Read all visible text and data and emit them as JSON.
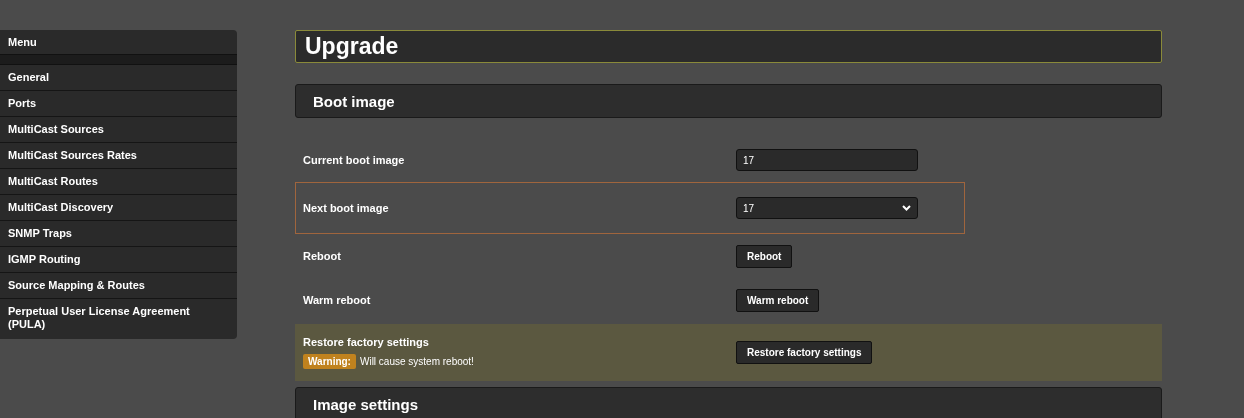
{
  "sidebar": {
    "title": "Menu",
    "items": [
      {
        "label": "General"
      },
      {
        "label": "Ports"
      },
      {
        "label": "MultiCast Sources"
      },
      {
        "label": "MultiCast Sources Rates"
      },
      {
        "label": "MultiCast Routes"
      },
      {
        "label": "MultiCast Discovery"
      },
      {
        "label": "SNMP Traps"
      },
      {
        "label": "IGMP Routing"
      },
      {
        "label": "Source Mapping & Routes"
      },
      {
        "label": "Perpetual User License Agreement (PULA)"
      }
    ]
  },
  "page_title": "Upgrade",
  "sections": [
    {
      "title": "Boot image",
      "rows": [
        {
          "kind": "field",
          "label": "Current boot image",
          "value": "17",
          "highlighted": false
        },
        {
          "kind": "select",
          "label": "Next boot image",
          "value": "17",
          "highlighted": true
        },
        {
          "kind": "button",
          "label": "Reboot",
          "button": "Reboot",
          "highlighted": false
        },
        {
          "kind": "button",
          "label": "Warm reboot",
          "button": "Warm reboot",
          "highlighted": false
        },
        {
          "kind": "danger",
          "label": "Restore factory settings",
          "button": "Restore factory settings",
          "warning_badge": "Warning:",
          "warning_text": "Will cause system reboot!",
          "highlighted": false
        }
      ]
    },
    {
      "title": "Image settings"
    }
  ]
}
